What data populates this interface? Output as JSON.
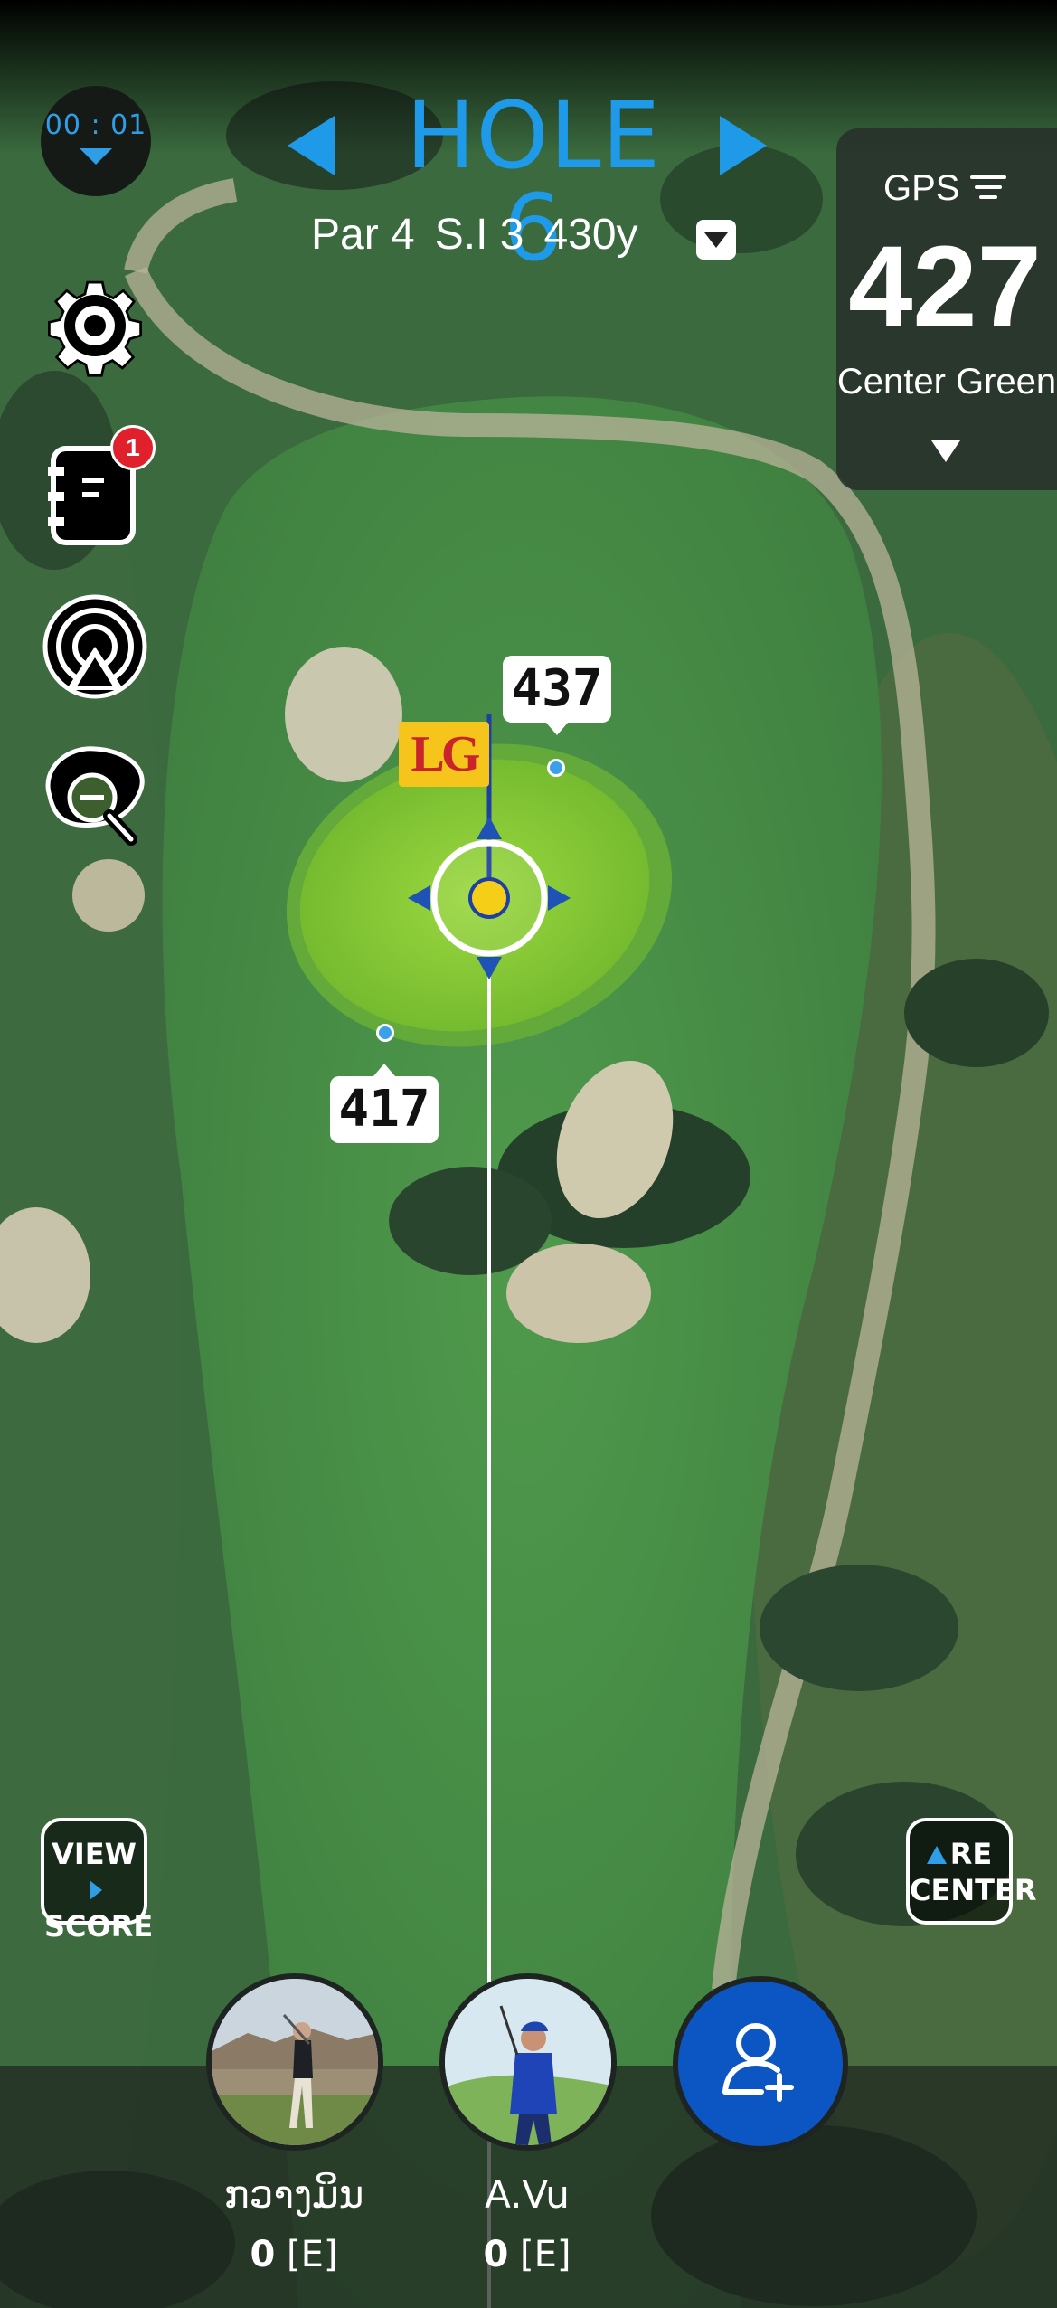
{
  "timer": {
    "value": "00 : 01"
  },
  "hole": {
    "title": "HOLE 6",
    "par": "Par 4",
    "stroke_index": "S.I 3",
    "length": "430y"
  },
  "gps": {
    "label": "GPS",
    "distance": "427",
    "target": "Center Green"
  },
  "sidebar": {
    "notes_badge": "1"
  },
  "map": {
    "distance_back": "437",
    "distance_front": "417",
    "flag_logo": "LG"
  },
  "buttons": {
    "view_score_line1": "VIEW",
    "view_score_line2": "SCORE",
    "recenter_line1": "RE",
    "recenter_line2": "CENTER"
  },
  "players": [
    {
      "name": "ກວາງມິນ",
      "score": "0",
      "relative": "[E]"
    },
    {
      "name": "A.Vu",
      "score": "0",
      "relative": "[E]"
    }
  ],
  "colors": {
    "accent": "#1e9ae8",
    "add_player": "#0c56c4",
    "notification": "#e0202a",
    "green": "#7cc23a"
  }
}
